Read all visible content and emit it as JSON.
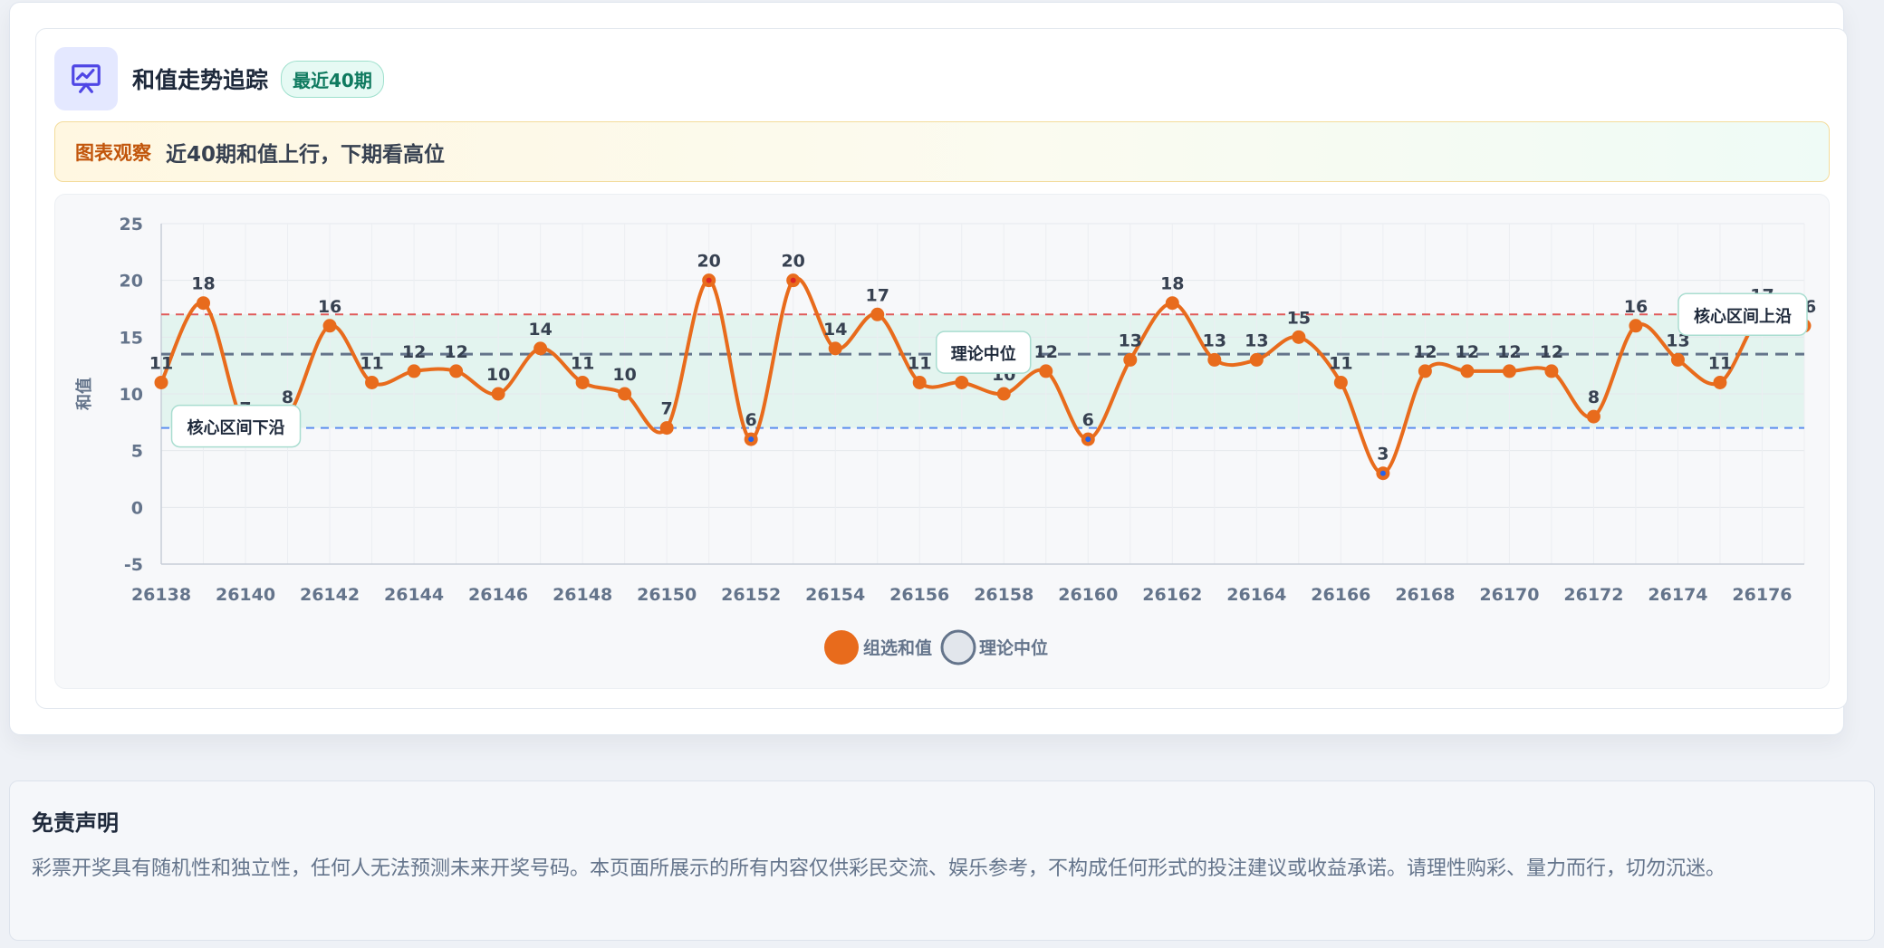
{
  "header": {
    "title": "和值走势追踪",
    "badge": "最近40期",
    "icon": "presentation-chart-icon",
    "accent": "#4f46e5"
  },
  "observation": {
    "label": "图表观察",
    "text": "近40期和值上行，下期看高位"
  },
  "chart_data": {
    "type": "line",
    "ylabel": "和值",
    "xlabel": "",
    "ylim": [
      -5,
      25
    ],
    "yticks": [
      -5,
      0,
      5,
      10,
      15,
      20,
      25
    ],
    "xtick_labels": [
      "26138",
      "26140",
      "26142",
      "26144",
      "26146",
      "26148",
      "26150",
      "26152",
      "26154",
      "26156",
      "26158",
      "26160",
      "26162",
      "26164",
      "26166",
      "26168",
      "26170",
      "26172",
      "26174",
      "26176"
    ],
    "grid": true,
    "legend_position": "bottom-center",
    "series": [
      {
        "name": "组选和值",
        "color": "#e86b1c",
        "x": [
          26138,
          26139,
          26140,
          26141,
          26142,
          26143,
          26144,
          26145,
          26146,
          26147,
          26148,
          26149,
          26150,
          26151,
          26152,
          26153,
          26154,
          26155,
          26156,
          26157,
          26158,
          26159,
          26160,
          26161,
          26162,
          26163,
          26164,
          26165,
          26166,
          26167,
          26168,
          26169,
          26170,
          26171,
          26172,
          26173,
          26174,
          26175,
          26176,
          26177
        ],
        "values": [
          11,
          18,
          7,
          8,
          16,
          11,
          12,
          12,
          10,
          14,
          11,
          10,
          7,
          20,
          6,
          20,
          14,
          17,
          11,
          11,
          10,
          12,
          6,
          13,
          18,
          13,
          13,
          15,
          11,
          3,
          12,
          12,
          12,
          12,
          8,
          16,
          13,
          11,
          17,
          16
        ]
      },
      {
        "name": "理论中位",
        "color": "#64748b",
        "value": 13.5
      }
    ],
    "reference_lines": [
      {
        "label": "核心区间上沿",
        "value": 17,
        "color": "#e05a5a"
      },
      {
        "label": "核心区间下沿",
        "value": 7,
        "color": "#5b8def"
      }
    ],
    "band": {
      "from": 7,
      "to": 17,
      "color": "#dff3ec"
    },
    "annotation_median": "理论中位",
    "highlight_max_color": "#dc2626",
    "highlight_min_color": "#2563eb"
  },
  "disclaimer": {
    "title": "免责声明",
    "text": "彩票开奖具有随机性和独立性，任何人无法预测未来开奖号码。本页面所展示的所有内容仅供彩民交流、娱乐参考，不构成任何形式的投注建议或收益承诺。请理性购彩、量力而行，切勿沉迷。"
  }
}
